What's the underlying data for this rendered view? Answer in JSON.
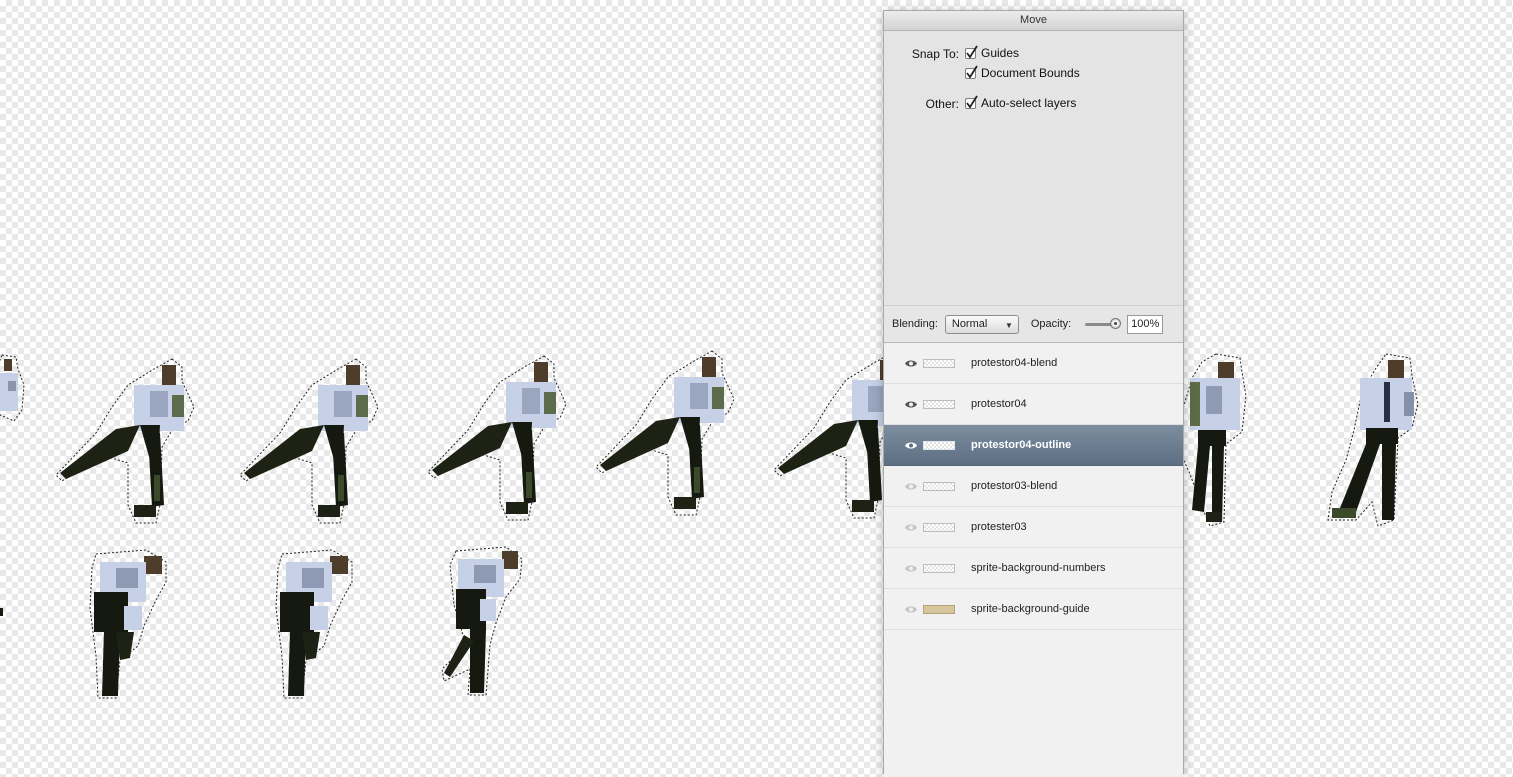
{
  "panel": {
    "title": "Move",
    "snap_label": "Snap To:",
    "snap_options": [
      "Guides",
      "Document Bounds"
    ],
    "other_label": "Other:",
    "other_options": [
      "Auto-select layers"
    ],
    "blending_label": "Blending:",
    "blending_value": "Normal",
    "opacity_label": "Opacity:",
    "opacity_value": "100%"
  },
  "layers": [
    {
      "name": "protestor04-blend",
      "selected": false,
      "visible": true,
      "thumb": "checker"
    },
    {
      "name": "protestor04",
      "selected": false,
      "visible": true,
      "thumb": "checker"
    },
    {
      "name": "protestor04-outline",
      "selected": true,
      "visible": true,
      "thumb": "checker"
    },
    {
      "name": "protestor03-blend",
      "selected": false,
      "visible": false,
      "thumb": "checker"
    },
    {
      "name": "protester03",
      "selected": false,
      "visible": false,
      "thumb": "checker"
    },
    {
      "name": "sprite-background-numbers",
      "selected": false,
      "visible": false,
      "thumb": "checker"
    },
    {
      "name": "sprite-background-guide",
      "selected": false,
      "visible": false,
      "thumb": "tan"
    }
  ],
  "colors": {
    "selected_row": "#5d6e83",
    "guide_thumb": "#d6c69e",
    "shirt": "#c6d0e6",
    "pants": "#15190f",
    "skin": "#4e3d2b"
  },
  "icons": {
    "eye": "eye-icon",
    "check": "checkmark-icon",
    "popup": "chevron-down-icon"
  }
}
